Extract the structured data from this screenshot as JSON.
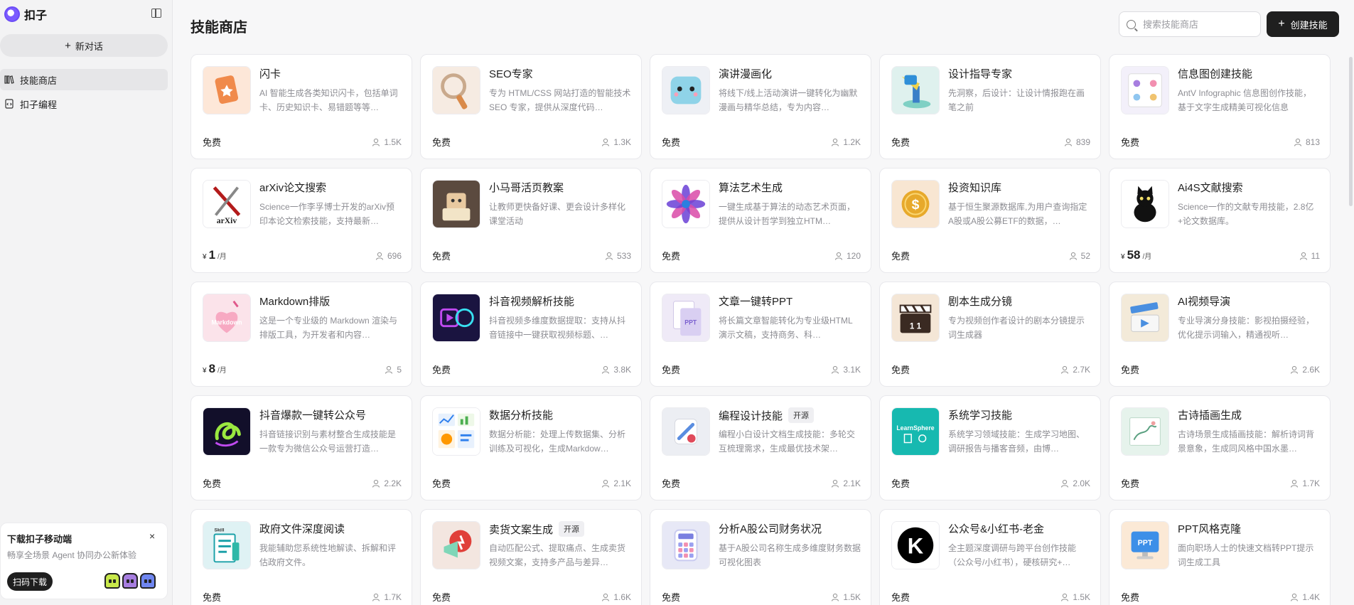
{
  "app": {
    "name": "扣子"
  },
  "sidebar": {
    "new_chat": "新对话",
    "items": [
      {
        "label": "技能商店",
        "icon": "library-icon",
        "active": true
      },
      {
        "label": "扣子编程",
        "icon": "code-icon",
        "active": false
      }
    ],
    "download": {
      "title": "下载扣子移动端",
      "subtitle": "畅享全场景 Agent 协同办公新体验",
      "button": "扫码下载",
      "close": "×"
    }
  },
  "header": {
    "title": "技能商店",
    "search_placeholder": "搜索技能商店",
    "create_label": "创建技能"
  },
  "cards": [
    {
      "name": "闪卡",
      "desc": "AI 智能生成各类知识闪卡，包括单词卡、历史知识卡、易错题等等…",
      "price": "免费",
      "users": "1.5K",
      "thumb": "flashcard-icon",
      "bg": "#fde7d8",
      "fg": "#f08a4b"
    },
    {
      "name": "SEO专家",
      "desc": "专为 HTML/CSS 网站打造的智能技术 SEO 专家，提供从深度代码…",
      "price": "免费",
      "users": "1.3K",
      "thumb": "magnifier-icon",
      "bg": "#f6ebe2",
      "fg": "#d98a4a"
    },
    {
      "name": "演讲漫画化",
      "desc": "将线下/线上活动演讲一键转化为幽默漫画与精华总结，专为内容…",
      "price": "免费",
      "users": "1.2K",
      "thumb": "cartoon-face-icon",
      "bg": "#eef0f5",
      "fg": "#8fd3e8"
    },
    {
      "name": "设计指导专家",
      "desc": "先洞察，后设计：让设计情报跑在画笔之前",
      "price": "免费",
      "users": "839",
      "thumb": "spotlight-icon",
      "bg": "#dff1ee",
      "fg": "#2f8fd8"
    },
    {
      "name": "信息图创建技能",
      "desc": "AntV Infographic 信息图创作技能，基于文字生成精美可视化信息",
      "price": "免费",
      "users": "813",
      "thumb": "infographic-icon",
      "bg": "#f3f0fa",
      "fg": "#a77ee0"
    },
    {
      "name": "arXiv论文搜索",
      "desc": "Science一作李孚博士开发的arXiv预印本论文检索技能，支持最新…",
      "price_amount": "1",
      "price_yen": "¥",
      "price_unit": "/月",
      "users": "696",
      "thumb": "arxiv-logo-icon",
      "thumb_text": "arXiv",
      "bg": "#ffffff",
      "fg": "#b31b1b"
    },
    {
      "name": "小马哥活页教案",
      "desc": "让教师更快备好课、更会设计多样化课堂活动",
      "price": "免费",
      "users": "533",
      "thumb": "robot-reading-icon",
      "bg": "#5b4a3f",
      "fg": "#e8c9a0"
    },
    {
      "name": "算法艺术生成",
      "desc": "一键生成基于算法的动态艺术页面，提供从设计哲学到独立HTM…",
      "price": "免费",
      "users": "120",
      "thumb": "mandala-icon",
      "bg": "#ffffff",
      "fg": "#6a3fd6"
    },
    {
      "name": "投资知识库",
      "desc": "基于恒生聚源数据库,为用户查询指定A股或A股公募ETF的数据，…",
      "price": "免费",
      "users": "52",
      "thumb": "coin-icon",
      "bg": "#f8e6d2",
      "fg": "#e7a92b"
    },
    {
      "name": "Ai4S文献搜索",
      "desc": "Science一作的文献专用技能，2.8亿+论文数据库。",
      "price_amount": "58",
      "price_yen": "¥",
      "price_unit": "/月",
      "users": "11",
      "thumb": "black-cat-icon",
      "bg": "#ffffff",
      "fg": "#111111"
    },
    {
      "name": "Markdown排版",
      "desc": "这是一个专业级的 Markdown 渲染与排版工具，为开发者和内容…",
      "price_amount": "8",
      "price_yen": "¥",
      "price_unit": "/月",
      "users": "5",
      "thumb": "markdown-icon",
      "thumb_text": "Markdown",
      "bg": "#fbe3ea",
      "fg": "#e0578a"
    },
    {
      "name": "抖音视频解析技能",
      "desc": "抖音视频多维度数据提取：支持从抖音链接中一键获取视频标题、…",
      "price": "免费",
      "users": "3.8K",
      "thumb": "video-brain-icon",
      "bg": "#1a1440",
      "fg": "#38e0f0"
    },
    {
      "name": "文章一键转PPT",
      "desc": "将长篇文章智能转化为专业级HTML演示文稿，支持商务、科…",
      "price": "免费",
      "users": "3.1K",
      "thumb": "document-ppt-icon",
      "bg": "#efeaf7",
      "fg": "#9b7fe0"
    },
    {
      "name": "剧本生成分镜",
      "desc": "专为视频创作者设计的剧本分镜提示词生成器",
      "price": "免费",
      "users": "2.7K",
      "thumb": "clapperboard-icon",
      "bg": "#f4e6d6",
      "fg": "#3a2a22"
    },
    {
      "name": "AI视频导演",
      "desc": "专业导演分身技能：影视拍摄经验，优化提示词输入，精通视听…",
      "price": "免费",
      "users": "2.6K",
      "thumb": "clapper-blue-icon",
      "bg": "#f3ead9",
      "fg": "#4a8fe0"
    },
    {
      "name": "抖音爆款一键转公众号",
      "desc": "抖音链接识别与素材整合生成技能是一款专为微信公众号运营打造…",
      "price": "免费",
      "users": "2.2K",
      "thumb": "neon-swirl-icon",
      "bg": "#120f2a",
      "fg": "#9be840"
    },
    {
      "name": "数据分析技能",
      "desc": "数据分析能：处理上传数据集、分析训练及可视化，生成Markdow…",
      "price": "免费",
      "users": "2.1K",
      "thumb": "dashboard-icon",
      "bg": "#ffffff",
      "fg": "#2f80ed"
    },
    {
      "name": "编程设计技能",
      "badge": "开源",
      "desc": "编程小白设计文档生成技能：多轮交互梳理需求，生成最优技术架…",
      "price": "免费",
      "users": "2.1K",
      "thumb": "tools-icon",
      "bg": "#eceef3",
      "fg": "#e04a5a"
    },
    {
      "name": "系统学习技能",
      "desc": "系统学习领域技能：生成学习地图、调研报告与播客音频，由博…",
      "price": "免费",
      "users": "2.0K",
      "thumb": "learnsphere-icon",
      "thumb_text": "LearnSphere",
      "bg": "#17b9b0",
      "fg": "#ffffff"
    },
    {
      "name": "古诗插画生成",
      "desc": "古诗场景生成插画技能：解析诗词背景意象，生成同风格中国水墨…",
      "price": "免费",
      "users": "1.7K",
      "thumb": "poem-sketch-icon",
      "bg": "#e6f3ec",
      "fg": "#5aa080"
    },
    {
      "name": "政府文件深度阅读",
      "desc": "我能辅助您系统性地解读、拆解和评估政府文件。",
      "price": "免费",
      "users": "1.7K",
      "thumb": "skill-doc-icon",
      "thumb_text": "Skill",
      "bg": "#dff2f4",
      "fg": "#1aa0a8"
    },
    {
      "name": "卖货文案生成",
      "badge": "开源",
      "desc": "自动匹配公式、提取痛点、生成卖货视频文案，支持多产品与差异…",
      "price": "免费",
      "users": "1.6K",
      "thumb": "megaphone-icon",
      "bg": "#f3e6e0",
      "fg": "#e0403a"
    },
    {
      "name": "分析A股公司财务状况",
      "desc": "基于A股公司名称生成多维度财务数据可视化图表",
      "price": "免费",
      "users": "1.5K",
      "thumb": "calculator-icon",
      "bg": "#e7e8f6",
      "fg": "#7a7fe0"
    },
    {
      "name": "公众号&小红书-老金",
      "desc": "全主题深度调研与跨平台创作技能（公众号/小红书），硬核研究+…",
      "price": "免费",
      "users": "1.5K",
      "thumb": "k-logo-icon",
      "thumb_text": "K",
      "bg": "#ffffff",
      "fg": "#000000"
    },
    {
      "name": "PPT风格克隆",
      "desc": "面向职场人士的快速文档转PPT提示词生成工具",
      "price": "免费",
      "users": "1.4K",
      "thumb": "ppt-monitor-icon",
      "thumb_text": "PPT",
      "bg": "#fbe9d6",
      "fg": "#3d8fe8"
    }
  ]
}
